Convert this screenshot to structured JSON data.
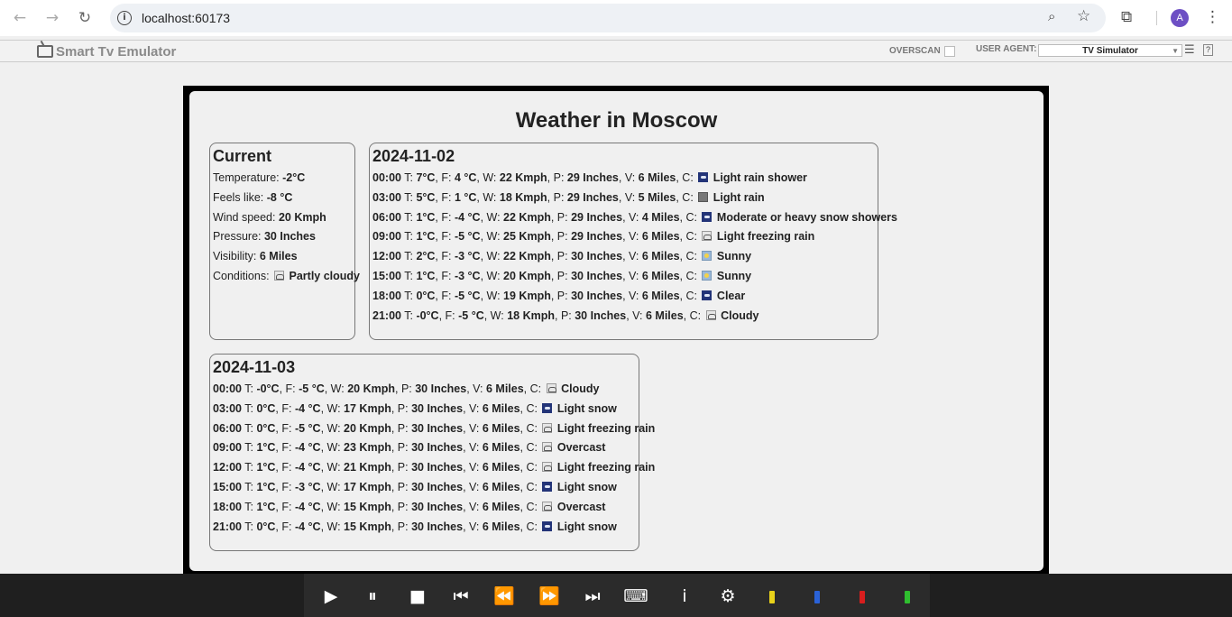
{
  "browser": {
    "url": "localhost:60173",
    "profile_initial": "A"
  },
  "emulator": {
    "title": "Smart Tv Emulator",
    "overscan_label": "OVERSCAN",
    "user_agent_label": "USER AGENT:",
    "user_agent_value": "TV Simulator",
    "help_label": "?"
  },
  "page": {
    "title": "Weather in Moscow"
  },
  "current": {
    "heading": "Current",
    "rows": [
      {
        "label": "Temperature: ",
        "value": "-2°C"
      },
      {
        "label": "Feels like: ",
        "value": "-8 °C"
      },
      {
        "label": "Wind speed: ",
        "value": "20 Kmph"
      },
      {
        "label": "Pressure: ",
        "value": "30 Inches"
      },
      {
        "label": "Visibility: ",
        "value": "6 Miles"
      },
      {
        "label": "Conditions: ",
        "value": "Partly cloudy",
        "icon": "partly-cloudy-icon"
      }
    ]
  },
  "days": [
    {
      "date": "2024-11-02",
      "hours": [
        {
          "time": "00:00",
          "t": "7°C",
          "f": "4 °C",
          "w": "22 Kmph",
          "p": "29 Inches",
          "v": "6 Miles",
          "c": "Light rain shower",
          "icon": "light-rain-shower-icon"
        },
        {
          "time": "03:00",
          "t": "5°C",
          "f": "1 °C",
          "w": "18 Kmph",
          "p": "29 Inches",
          "v": "5 Miles",
          "c": "Light rain",
          "icon": "light-rain-icon"
        },
        {
          "time": "06:00",
          "t": "1°C",
          "f": "-4 °C",
          "w": "22 Kmph",
          "p": "29 Inches",
          "v": "4 Miles",
          "c": "Moderate or heavy snow showers",
          "icon": "heavy-snow-icon"
        },
        {
          "time": "09:00",
          "t": "1°C",
          "f": "-5 °C",
          "w": "25 Kmph",
          "p": "29 Inches",
          "v": "6 Miles",
          "c": "Light freezing rain",
          "icon": "freezing-rain-icon"
        },
        {
          "time": "12:00",
          "t": "2°C",
          "f": "-3 °C",
          "w": "22 Kmph",
          "p": "30 Inches",
          "v": "6 Miles",
          "c": "Sunny",
          "icon": "sunny-icon"
        },
        {
          "time": "15:00",
          "t": "1°C",
          "f": "-3 °C",
          "w": "20 Kmph",
          "p": "30 Inches",
          "v": "6 Miles",
          "c": "Sunny",
          "icon": "sunny-icon"
        },
        {
          "time": "18:00",
          "t": "0°C",
          "f": "-5 °C",
          "w": "19 Kmph",
          "p": "30 Inches",
          "v": "6 Miles",
          "c": "Clear",
          "icon": "clear-night-icon"
        },
        {
          "time": "21:00",
          "t": "-0°C",
          "f": "-5 °C",
          "w": "18 Kmph",
          "p": "30 Inches",
          "v": "6 Miles",
          "c": "Cloudy",
          "icon": "cloudy-icon"
        }
      ]
    },
    {
      "date": "2024-11-03",
      "hours": [
        {
          "time": "00:00",
          "t": "-0°C",
          "f": "-5 °C",
          "w": "20 Kmph",
          "p": "30 Inches",
          "v": "6 Miles",
          "c": "Cloudy",
          "icon": "cloudy-icon"
        },
        {
          "time": "03:00",
          "t": "0°C",
          "f": "-4 °C",
          "w": "17 Kmph",
          "p": "30 Inches",
          "v": "6 Miles",
          "c": "Light snow",
          "icon": "light-snow-icon"
        },
        {
          "time": "06:00",
          "t": "0°C",
          "f": "-5 °C",
          "w": "20 Kmph",
          "p": "30 Inches",
          "v": "6 Miles",
          "c": "Light freezing rain",
          "icon": "freezing-rain-icon"
        },
        {
          "time": "09:00",
          "t": "1°C",
          "f": "-4 °C",
          "w": "23 Kmph",
          "p": "30 Inches",
          "v": "6 Miles",
          "c": "Overcast",
          "icon": "overcast-icon"
        },
        {
          "time": "12:00",
          "t": "1°C",
          "f": "-4 °C",
          "w": "21 Kmph",
          "p": "30 Inches",
          "v": "6 Miles",
          "c": "Light freezing rain",
          "icon": "freezing-rain-icon"
        },
        {
          "time": "15:00",
          "t": "1°C",
          "f": "-3 °C",
          "w": "17 Kmph",
          "p": "30 Inches",
          "v": "6 Miles",
          "c": "Light snow",
          "icon": "light-snow-icon"
        },
        {
          "time": "18:00",
          "t": "1°C",
          "f": "-4 °C",
          "w": "15 Kmph",
          "p": "30 Inches",
          "v": "6 Miles",
          "c": "Overcast",
          "icon": "overcast-icon"
        },
        {
          "time": "21:00",
          "t": "0°C",
          "f": "-4 °C",
          "w": "15 Kmph",
          "p": "30 Inches",
          "v": "6 Miles",
          "c": "Light snow",
          "icon": "light-snow-icon"
        }
      ]
    }
  ],
  "remote": {
    "buttons": [
      "play-icon",
      "pause-icon",
      "stop-icon",
      "skip-back-icon",
      "rewind-icon",
      "fast-forward-icon",
      "skip-forward-icon",
      "keyboard-icon",
      "info-icon",
      "settings-icon"
    ],
    "color_keys": [
      "#e8d21a",
      "#2a62d8",
      "#d81e1e",
      "#2fbf2f"
    ]
  }
}
